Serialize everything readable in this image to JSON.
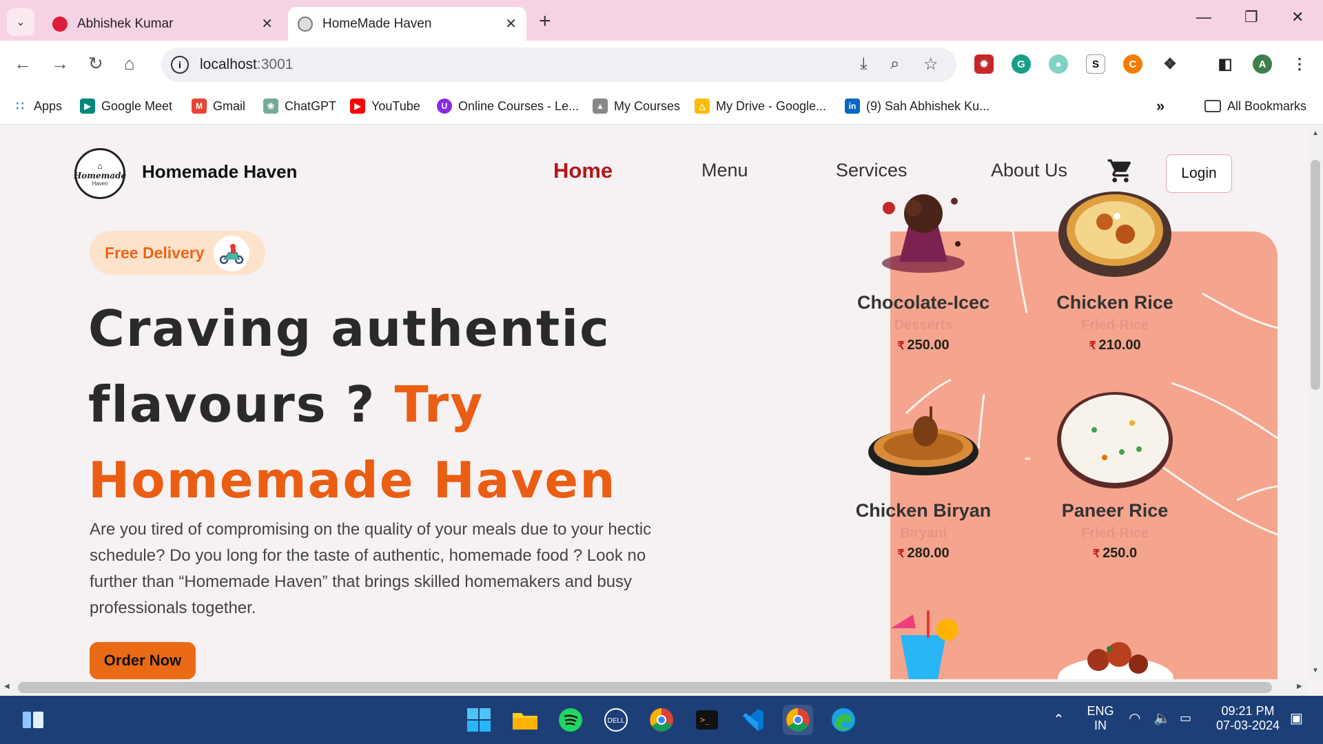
{
  "browser": {
    "tabs": [
      {
        "title": "Abhishek Kumar"
      },
      {
        "title": "HomeMade Haven",
        "active": true
      }
    ],
    "url_host": "localhost",
    "url_port": ":3001",
    "bookmarks": [
      {
        "label": "Apps",
        "color": "#4285f4"
      },
      {
        "label": "Google Meet",
        "color": "#00897b"
      },
      {
        "label": "Gmail",
        "color": "#ea4335"
      },
      {
        "label": "ChatGPT",
        "color": "#74aa9c"
      },
      {
        "label": "YouTube",
        "color": "#ff0000"
      },
      {
        "label": "Online Courses - Le...",
        "color": "#8a2be2"
      },
      {
        "label": "My Courses",
        "color": "#555555"
      },
      {
        "label": "My Drive - Google...",
        "color": "#fbbc04"
      },
      {
        "label": "(9) Sah Abhishek Ku...",
        "color": "#0a66c2"
      }
    ],
    "all_bookmarks": "All Bookmarks"
  },
  "site": {
    "logo_text": "Homemade",
    "logo_sub": "Haven",
    "brand": "Homemade Haven",
    "nav": [
      "Home",
      "Menu",
      "Services",
      "About Us"
    ],
    "login": "Login"
  },
  "hero": {
    "badge": "Free Delivery",
    "line1": "Craving authentic",
    "line2": "flavours ? ",
    "line2_accent": "Try",
    "line3": "Homemade Haven",
    "paragraph": "Are you tired of compromising on the quality of your meals due to your hectic schedule? Do you long for the taste of authentic, homemade food ? Look no further than “Homemade Haven” that brings skilled homemakers and busy professionals together.",
    "cta": "Order Now"
  },
  "foods": [
    {
      "name": "Chocolate-Icec",
      "category": "Desserts",
      "price": "250.00"
    },
    {
      "name": "Chicken Rice",
      "category": "Fried-Rice",
      "price": "210.00"
    },
    {
      "name": "Chicken Biryan",
      "category": "Biryani",
      "price": "280.00"
    },
    {
      "name": "Paneer Rice",
      "category": "Fried-Rice",
      "price": "250.0"
    }
  ],
  "currency": "₹",
  "taskbar": {
    "lang1": "ENG",
    "lang2": "IN",
    "time": "09:21 PM",
    "date": "07-03-2024"
  },
  "colors": {
    "accent_orange": "#ea5d12",
    "active_nav": "#b3161b",
    "panel": "#f5a58d"
  }
}
